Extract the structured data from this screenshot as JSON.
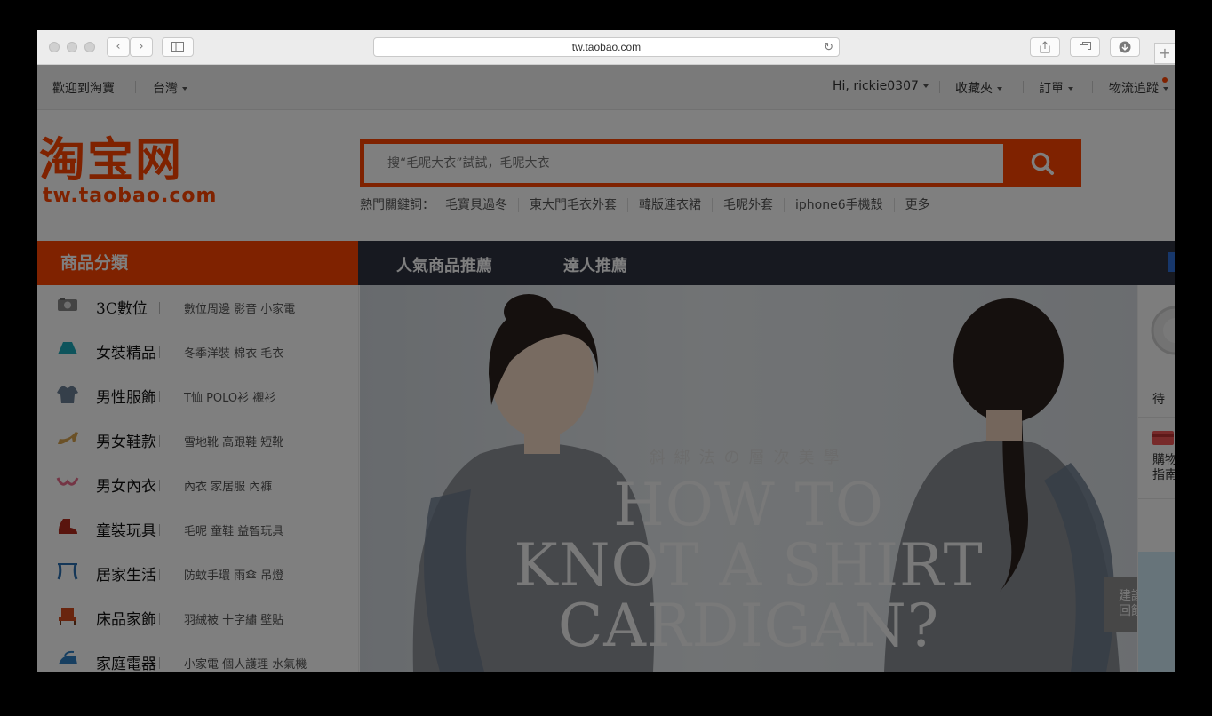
{
  "browser": {
    "url": "tw.taobao.com"
  },
  "topbar": {
    "welcome": "歡迎到淘寶",
    "region": "台灣",
    "user": "Hi, rickie0307",
    "favorites": "收藏夾",
    "orders": "訂單",
    "logistics": "物流追蹤"
  },
  "logo": {
    "name": "淘宝网",
    "domain": "tw.taobao.com"
  },
  "search": {
    "placeholder": "搜“毛呢大衣”試試，毛呢大衣",
    "hot_label": "熱門關鍵詞：",
    "hot_keywords": [
      "毛寶貝過冬",
      "東大門毛衣外套",
      "韓版連衣裙",
      "毛呢外套",
      "iphone6手機殼",
      "更多"
    ]
  },
  "nav": {
    "category_title": "商品分類",
    "tabs": [
      "人氣商品推薦",
      "達人推薦"
    ]
  },
  "categories": [
    {
      "icon": "camera-icon",
      "name": "3C數位",
      "subs": "數位周邊 影音 小家電"
    },
    {
      "icon": "skirt-icon",
      "name": "女裝精品",
      "subs": "冬季洋裝 棉衣 毛衣"
    },
    {
      "icon": "shirt-icon",
      "name": "男性服飾",
      "subs": "T恤 POLO衫 襯衫"
    },
    {
      "icon": "heel-icon",
      "name": "男女鞋款",
      "subs": "雪地靴 高跟鞋 短靴"
    },
    {
      "icon": "bra-icon",
      "name": "男女內衣",
      "subs": "內衣 家居服 內褲"
    },
    {
      "icon": "baby-shoe-icon",
      "name": "童裝玩具",
      "subs": "毛呢 童鞋 益智玩具"
    },
    {
      "icon": "curtain-icon",
      "name": "居家生活",
      "subs": "防蚊手環 雨傘 吊燈"
    },
    {
      "icon": "armchair-icon",
      "name": "床品家飾",
      "subs": "羽絨被 十字繡 壁貼"
    },
    {
      "icon": "iron-icon",
      "name": "家庭電器",
      "subs": "小家電 個人護理 水氣機"
    }
  ],
  "banner": {
    "tagline": "斜綁法の層次美學",
    "headline_1": "HOW TO",
    "headline_2": "KNOT A SHIRT",
    "headline_3": "CARDIGAN?"
  },
  "right_panel": {
    "item_1": "待",
    "item_2a": "購物",
    "item_2b": "指南"
  },
  "feedback": {
    "line1": "建議",
    "line2": "回饋"
  },
  "colors": {
    "brand": "#ff4400",
    "nav_dark": "#2e3240"
  }
}
